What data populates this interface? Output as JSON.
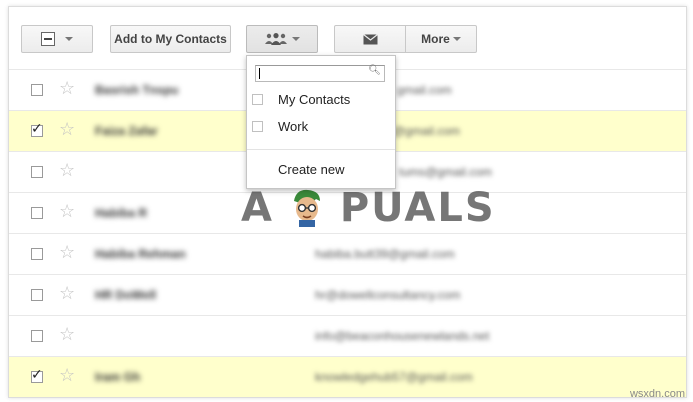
{
  "toolbar": {
    "add_contacts_label": "Add to My Contacts",
    "more_label": "More"
  },
  "contacts": [
    {
      "name": "Basrish Tnspu",
      "email": "gmail.com",
      "checked": false,
      "starred": false
    },
    {
      "name": "Faiza Zafar",
      "email": "@gmail.com",
      "checked": true,
      "starred": false
    },
    {
      "name": "",
      "email": "tums@gmail.com",
      "checked": false,
      "starred": false
    },
    {
      "name": "Habiba R",
      "email": "",
      "checked": false,
      "starred": false
    },
    {
      "name": "Habiba Rehman",
      "email": "habiba.butt39@gmail.com",
      "checked": false,
      "starred": false
    },
    {
      "name": "HR DoWell",
      "email": "hr@dowellconsultancy.com",
      "checked": false,
      "starred": false
    },
    {
      "name": "",
      "email": "info@beaconhousenewlands.net",
      "checked": false,
      "starred": false
    },
    {
      "name": "Iram Gh",
      "email": "knowledgehub57@gmail.com",
      "checked": true,
      "starred": false
    }
  ],
  "group_menu": {
    "search_value": "",
    "items": [
      {
        "label": "My Contacts"
      },
      {
        "label": "Work"
      }
    ],
    "create_new_label": "Create new"
  },
  "watermark": {
    "text_left": "A",
    "text_right": "PUALS"
  },
  "site_mark": "wsxdn.com",
  "colors": {
    "selected_row": "#ffffcc",
    "button_border": "#c8c8c8"
  },
  "icons": {
    "select_all": "checkbox-minus-icon",
    "groups": "people-icon",
    "mail": "envelope-icon",
    "star": "star-icon",
    "search": "magnifier-icon"
  }
}
